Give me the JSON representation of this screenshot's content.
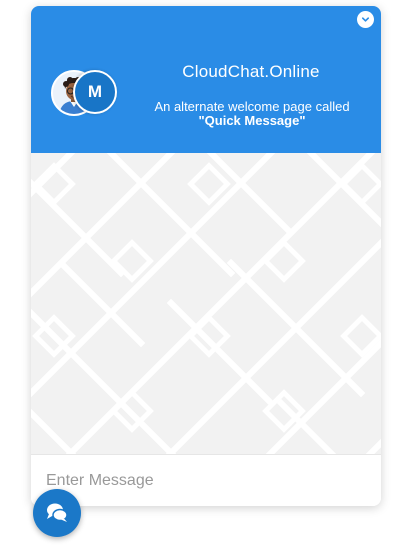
{
  "widget": {
    "title": "CloudChat.Online",
    "subtitle_line1": "An alternate welcome page called",
    "subtitle_line2": "\"Quick Message\"",
    "avatar_initial": "M",
    "header_color": "#2a8ce6",
    "accent_color": "#1875c7"
  },
  "icons": {
    "minimize": "chevron-down-icon",
    "launcher": "chat-bubbles-icon",
    "avatar_photo": "cartoon-person-avatar"
  },
  "composer": {
    "placeholder": "Enter Message",
    "value": ""
  }
}
